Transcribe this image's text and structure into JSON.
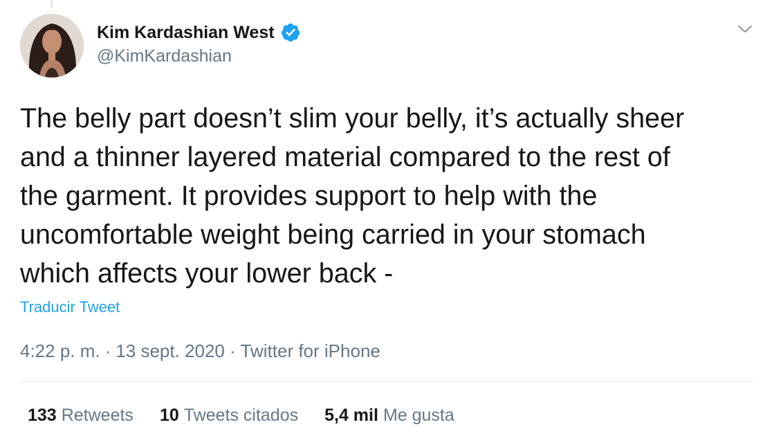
{
  "author": {
    "display_name": "Kim Kardashian West",
    "handle": "@KimKardashian",
    "verified": true
  },
  "tweet": {
    "lines": [
      "The belly part doesn’t slim your belly, it’s actually sheer",
      "and a thinner layered material compared to the rest of",
      "the garment. It provides support to help with the",
      "uncomfortable weight being carried in your stomach",
      "which affects your lower back -"
    ],
    "translate_label": "Traducir Tweet"
  },
  "meta": {
    "time": "4:22 p. m.",
    "separator": "·",
    "date": "13 sept. 2020",
    "source": "Twitter for iPhone"
  },
  "stats": {
    "retweets": {
      "count": "133",
      "label": "Retweets"
    },
    "quotes": {
      "count": "10",
      "label": "Tweets citados"
    },
    "likes": {
      "count": "5,4 mil",
      "label": "Me gusta"
    }
  },
  "icons": {
    "verified": "verified-badge-icon",
    "menu": "chevron-down-icon"
  },
  "colors": {
    "link": "#1da1f2",
    "secondary_text": "#657786",
    "primary_text": "#14171a",
    "divider": "#e6ecf0"
  }
}
